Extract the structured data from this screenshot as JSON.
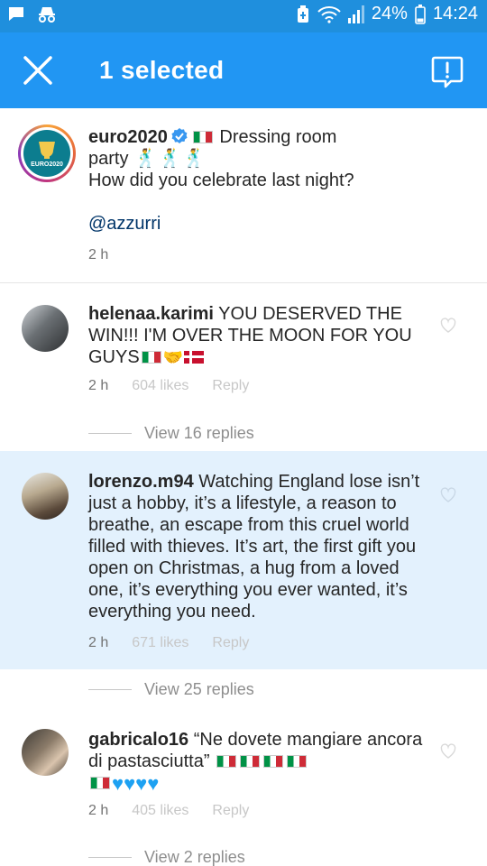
{
  "status_bar": {
    "battery_pct": "24%",
    "time": "14:24"
  },
  "app_bar": {
    "title": "1 selected"
  },
  "caption": {
    "username": "euro2020",
    "text_line1": "Dressing room",
    "text_line2": "party",
    "text_line3": "How did you celebrate last night?",
    "mention": "@azzurri",
    "time": "2 h"
  },
  "comments": [
    {
      "username": "helenaa.karimi",
      "text": "YOU DESERVED THE WIN!!! I'M OVER THE MOON FOR YOU GUYS",
      "time": "2 h",
      "likes": "604 likes",
      "reply": "Reply",
      "view_replies": "View 16 replies"
    },
    {
      "username": "lorenzo.m94",
      "text": "Watching England lose isn’t just a hobby, it’s a lifestyle, a reason to breathe, an escape from this cruel world filled with thieves. It’s art, the first gift you open on Christmas, a hug from a loved one, it’s everything you ever wanted, it’s everything you need.",
      "time": "2 h",
      "likes": "671 likes",
      "reply": "Reply",
      "view_replies": "View 25 replies"
    },
    {
      "username": "gabricalo16",
      "text": "“Ne dovete mangiare ancora di pastasciutta”",
      "time": "2 h",
      "likes": "405 likes",
      "reply": "Reply",
      "view_replies": "View 2 replies"
    }
  ],
  "colors": {
    "status_bar": "#1f8fdd",
    "app_bar": "#2196f3",
    "selected_row": "#e3f1fd",
    "verified": "#3897f0"
  }
}
